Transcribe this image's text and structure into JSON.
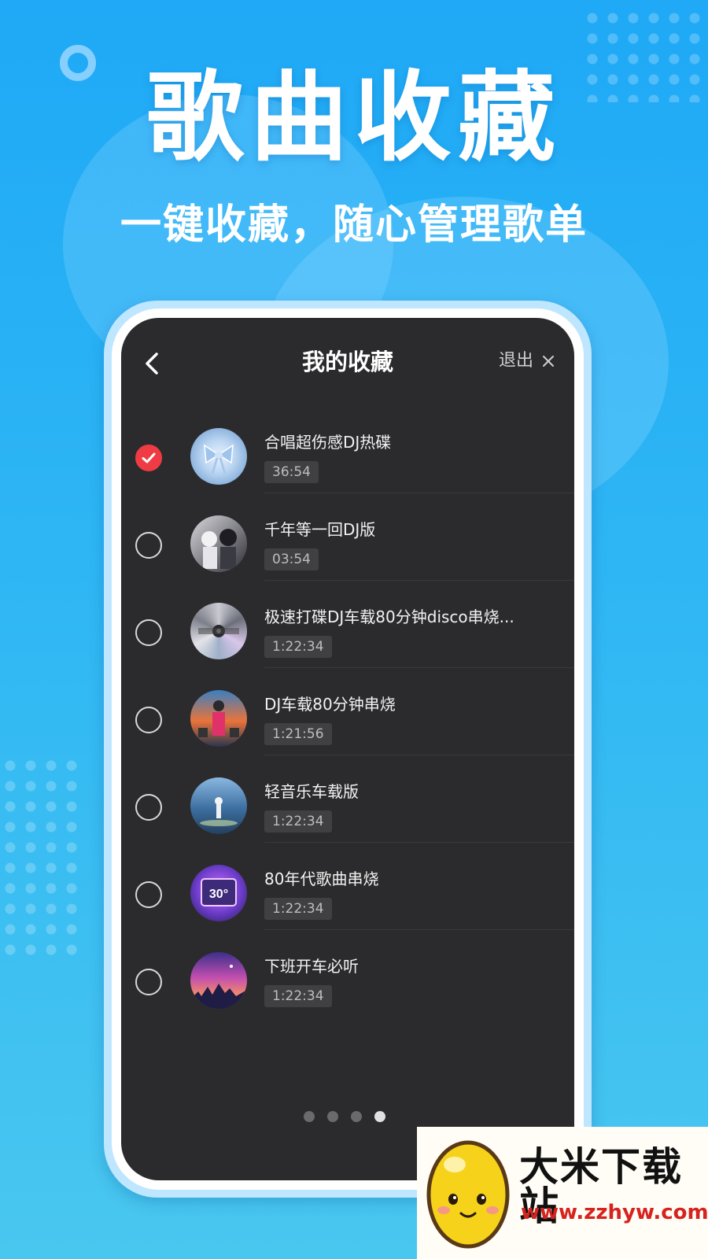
{
  "hero": {
    "title": "歌曲收藏",
    "subtitle": "一键收藏，随心管理歌单"
  },
  "nav": {
    "back_icon": "chevron-left-icon",
    "title": "我的收藏",
    "exit_label": "退出",
    "close_icon": "close-icon"
  },
  "songs": [
    {
      "title": "合唱超伤感DJ热碟",
      "duration": "36:54",
      "checked": true
    },
    {
      "title": "千年等一回DJ版",
      "duration": "03:54",
      "checked": false
    },
    {
      "title": "极速打碟DJ车载80分钟disco串烧...",
      "duration": "1:22:34",
      "checked": false
    },
    {
      "title": "DJ车载80分钟串烧",
      "duration": "1:21:56",
      "checked": false
    },
    {
      "title": "轻音乐车载版",
      "duration": "1:22:34",
      "checked": false
    },
    {
      "title": "80年代歌曲串烧",
      "duration": "1:22:34",
      "checked": false
    },
    {
      "title": "下班开车必听",
      "duration": "1:22:34",
      "checked": false
    }
  ],
  "pager": {
    "count": 4,
    "active_index": 3
  },
  "watermark": {
    "name": "大米下载站",
    "url": "www.zzhyw.com"
  },
  "colors": {
    "accent_red": "#ee3b44",
    "screen_bg": "#2b2b2d",
    "sky_blue": "#1fa9f6"
  }
}
